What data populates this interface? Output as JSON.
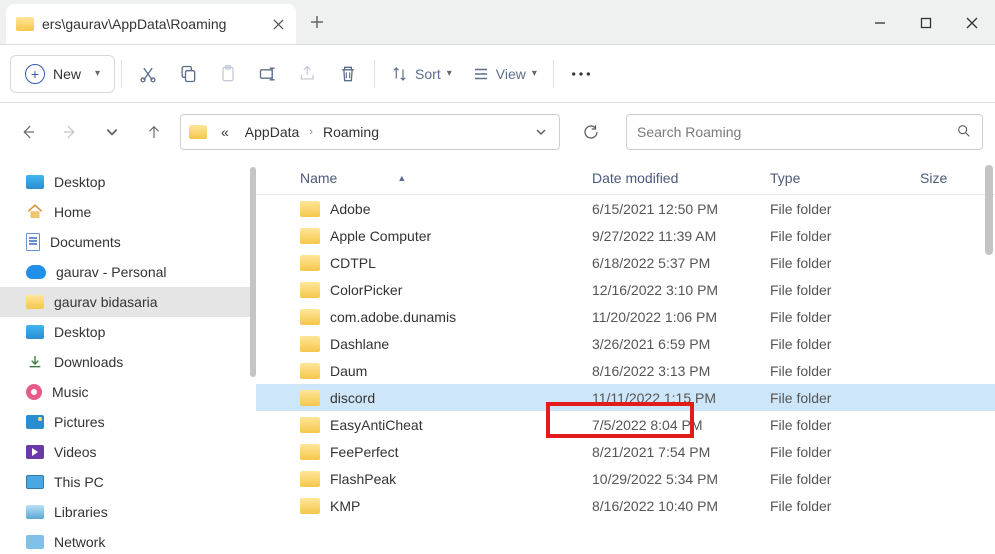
{
  "tab": {
    "title": "ers\\gaurav\\AppData\\Roaming"
  },
  "toolbar": {
    "new_label": "New",
    "sort_label": "Sort",
    "view_label": "View"
  },
  "breadcrumbs": {
    "prefix": "«",
    "seg1": "AppData",
    "seg2": "Roaming"
  },
  "search": {
    "placeholder": "Search Roaming"
  },
  "navpane": {
    "items": [
      {
        "label": "Desktop",
        "icon": "desktop"
      },
      {
        "label": "Home",
        "icon": "home"
      },
      {
        "label": "Documents",
        "icon": "doc"
      },
      {
        "label": "gaurav - Personal",
        "icon": "cloud"
      },
      {
        "label": "gaurav bidasaria",
        "icon": "folder",
        "selected": true
      },
      {
        "label": "Desktop",
        "icon": "desktop"
      },
      {
        "label": "Downloads",
        "icon": "dl"
      },
      {
        "label": "Music",
        "icon": "music"
      },
      {
        "label": "Pictures",
        "icon": "pic"
      },
      {
        "label": "Videos",
        "icon": "vid"
      },
      {
        "label": "This PC",
        "icon": "pc"
      },
      {
        "label": "Libraries",
        "icon": "lib"
      },
      {
        "label": "Network",
        "icon": "net"
      }
    ]
  },
  "columns": {
    "name": "Name",
    "date": "Date modified",
    "type": "Type",
    "size": "Size"
  },
  "files": [
    {
      "name": "Adobe",
      "date": "6/15/2021 12:50 PM",
      "type": "File folder"
    },
    {
      "name": "Apple Computer",
      "date": "9/27/2022 11:39 AM",
      "type": "File folder"
    },
    {
      "name": "CDTPL",
      "date": "6/18/2022 5:37 PM",
      "type": "File folder"
    },
    {
      "name": "ColorPicker",
      "date": "12/16/2022 3:10 PM",
      "type": "File folder"
    },
    {
      "name": "com.adobe.dunamis",
      "date": "11/20/2022 1:06 PM",
      "type": "File folder"
    },
    {
      "name": "Dashlane",
      "date": "3/26/2021 6:59 PM",
      "type": "File folder"
    },
    {
      "name": "Daum",
      "date": "8/16/2022 3:13 PM",
      "type": "File folder"
    },
    {
      "name": "discord",
      "date": "11/11/2022 1:15 PM",
      "type": "File folder",
      "selected": true,
      "highlighted": true
    },
    {
      "name": "EasyAntiCheat",
      "date": "7/5/2022 8:04 PM",
      "type": "File folder"
    },
    {
      "name": "FeePerfect",
      "date": "8/21/2021 7:54 PM",
      "type": "File folder"
    },
    {
      "name": "FlashPeak",
      "date": "10/29/2022 5:34 PM",
      "type": "File folder"
    },
    {
      "name": "KMP",
      "date": "8/16/2022 10:40 PM",
      "type": "File folder"
    }
  ]
}
